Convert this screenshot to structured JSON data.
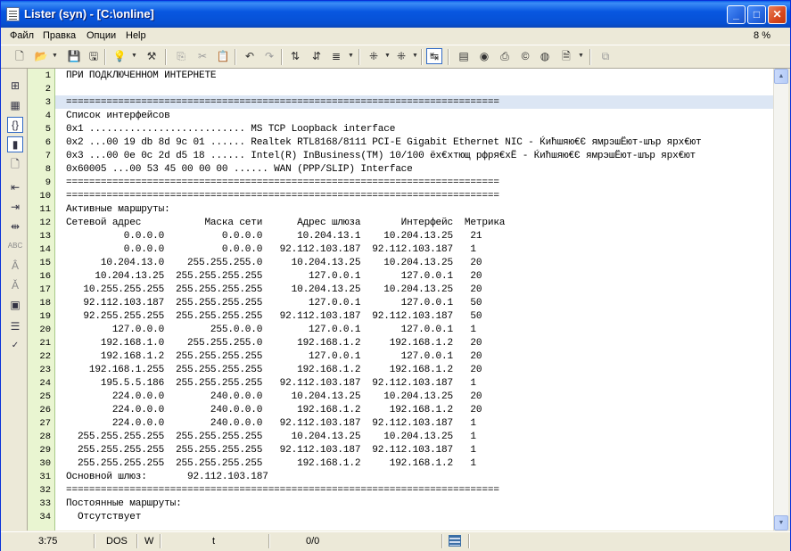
{
  "window": {
    "title": "Lister (syn) - [C:\\online]"
  },
  "title_buttons": {
    "minimize": "_",
    "maximize": "□",
    "close": "✕"
  },
  "menu": [
    "Файл",
    "Правка",
    "Опции",
    "Help"
  ],
  "zoom": "8 %",
  "toolbar_icons": [
    "new-file-icon",
    "open-icon",
    "save-icon",
    "save-as-icon",
    "settings-icon",
    "hint-icon",
    "tools-icon",
    "copy-icon",
    "cut-icon",
    "paste-icon",
    "undo-icon",
    "redo-icon",
    "sort-asc-icon",
    "sort-desc-icon",
    "format-icon",
    "indent-icon",
    "outdent-icon",
    "word-wrap-icon",
    "export-icon",
    "web-icon",
    "print-icon",
    "copyright-icon",
    "nic-icon",
    "page-icon",
    "encoding-icon"
  ],
  "sidebar_icons": [
    "tree-icon",
    "structure-icon",
    "bracket-icon",
    "highlight-icon",
    "document-icon",
    "indent-left-icon",
    "indent-right-icon",
    "align-icon",
    "abc-icon",
    "font-size-up-icon",
    "font-size-down-icon",
    "calendar-icon",
    "list-icon",
    "spellcheck-icon"
  ],
  "lines": [
    "ПРИ ПОДКЛЮЧЕННОМ ИНТЕРНЕТЕ",
    "",
    "===========================================================================",
    "Список интерфейсов",
    "0x1 ........................... MS TCP Loopback interface",
    "0x2 ...00 19 db 8d 9c 01 ...... Realtek RTL8168/8111 PCI-E Gigabit Ethernet NIC - Ќићшяю€Є ямрэшЁют-шър ярх€ют",
    "0x3 ...00 0e 0c 2d d5 18 ...... Intel(R) InBusiness(TM) 10/100 ёх€хтющ рфря€хЁ - Ќићшяю€Є ямрэшЁют-шър ярх€ют",
    "0x60005 ...00 53 45 00 00 00 ...... WAN (PPP/SLIP) Interface",
    "===========================================================================",
    "===========================================================================",
    "Активные маршруты:",
    "Сетевой адрес           Маска сети      Адрес шлюза       Интерфейс  Метрика",
    "          0.0.0.0          0.0.0.0      10.204.13.1    10.204.13.25   21",
    "          0.0.0.0          0.0.0.0   92.112.103.187  92.112.103.187   1",
    "      10.204.13.0    255.255.255.0     10.204.13.25    10.204.13.25   20",
    "     10.204.13.25  255.255.255.255        127.0.0.1       127.0.0.1   20",
    "   10.255.255.255  255.255.255.255     10.204.13.25    10.204.13.25   20",
    "   92.112.103.187  255.255.255.255        127.0.0.1       127.0.0.1   50",
    "   92.255.255.255  255.255.255.255   92.112.103.187  92.112.103.187   50",
    "        127.0.0.0        255.0.0.0        127.0.0.1       127.0.0.1   1",
    "      192.168.1.0    255.255.255.0      192.168.1.2     192.168.1.2   20",
    "      192.168.1.2  255.255.255.255        127.0.0.1       127.0.0.1   20",
    "    192.168.1.255  255.255.255.255      192.168.1.2     192.168.1.2   20",
    "      195.5.5.186  255.255.255.255   92.112.103.187  92.112.103.187   1",
    "        224.0.0.0        240.0.0.0     10.204.13.25    10.204.13.25   20",
    "        224.0.0.0        240.0.0.0      192.168.1.2     192.168.1.2   20",
    "        224.0.0.0        240.0.0.0   92.112.103.187  92.112.103.187   1",
    "  255.255.255.255  255.255.255.255     10.204.13.25    10.204.13.25   1",
    "  255.255.255.255  255.255.255.255   92.112.103.187  92.112.103.187   1",
    "  255.255.255.255  255.255.255.255      192.168.1.2     192.168.1.2   1",
    "Основной шлюз:       92.112.103.187",
    "===========================================================================",
    "Постоянные маршруты:",
    "  Отсутствует"
  ],
  "status": {
    "position": "3:75",
    "line_endings": "DOS",
    "mode": "W",
    "tab": "t",
    "selection": "0/0"
  }
}
